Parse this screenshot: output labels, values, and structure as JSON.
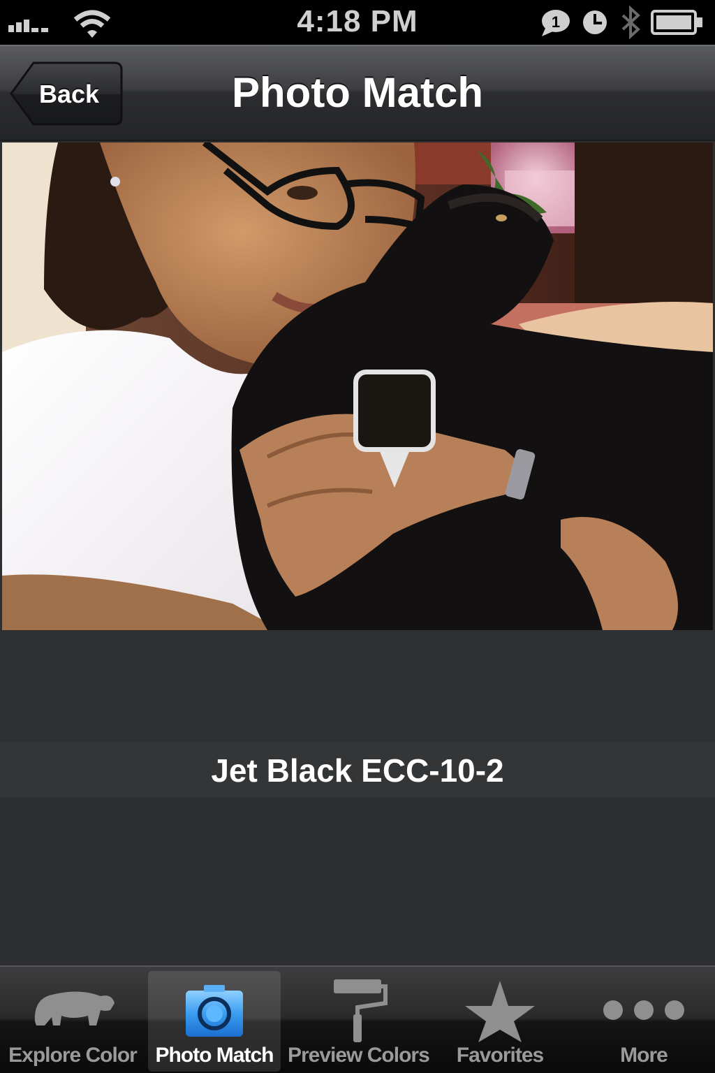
{
  "status_bar": {
    "time": "4:18 PM",
    "notification_count": "1",
    "icons": [
      "signal-icon",
      "wifi-icon",
      "notification-icon",
      "alarm-icon",
      "bluetooth-icon",
      "battery-icon"
    ]
  },
  "nav": {
    "back_label": "Back",
    "title": "Photo Match"
  },
  "photo": {
    "picked_swatch_color": "#1a1713"
  },
  "result": {
    "color_name": "Jet Black ECC-10-2"
  },
  "tabs": [
    {
      "label": "Explore Color",
      "icon": "bear-icon",
      "selected": false
    },
    {
      "label": "Photo Match",
      "icon": "camera-icon",
      "selected": true
    },
    {
      "label": "Preview Colors",
      "icon": "paint-roller-icon",
      "selected": false
    },
    {
      "label": "Favorites",
      "icon": "star-icon",
      "selected": false
    },
    {
      "label": "More",
      "icon": "more-dots-icon",
      "selected": false
    }
  ],
  "colors": {
    "accent_selected_tab": "#4aa3ea",
    "background": "#2e2f31"
  }
}
